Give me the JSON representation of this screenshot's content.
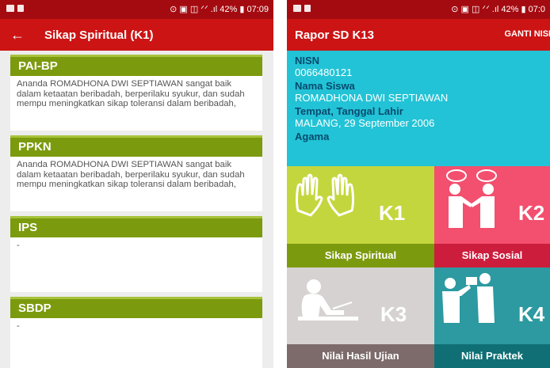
{
  "left_screen": {
    "status": {
      "text": "⊙ ▣ ◫ ᐟᐟ .ıl 42% ▮ 07:09"
    },
    "appbar": {
      "back_icon": "back-arrow-icon",
      "title": "Sikap Spiritual (K1)"
    },
    "cards": [
      {
        "title": "PAI-BP",
        "text": "Ananda ROMADHONA DWI SEPTIAWAN sangat baik dalam ketaatan beribadah, berperilaku syukur, dan sudah mempu meningkatkan sikap toleransi dalam beribadah,"
      },
      {
        "title": "PPKN",
        "text": "Ananda ROMADHONA DWI SEPTIAWAN sangat baik dalam ketaatan beribadah, berperilaku syukur, dan sudah mempu meningkatkan sikap toleransi dalam beribadah,"
      },
      {
        "title": "IPS",
        "text": "-"
      },
      {
        "title": "SBDP",
        "text": "-"
      }
    ]
  },
  "right_screen": {
    "status": {
      "text": "⊙ ▣ ◫ ᐟᐟ .ıl 42% ▮ 07:0"
    },
    "appbar": {
      "title": "Rapor SD K13",
      "action": "GANTI NISN"
    },
    "info": {
      "nisn_label": "NISN",
      "nisn": "0066480121",
      "name_label": "Nama Siswa",
      "name": "ROMADHONA DWI SEPTIAWAN",
      "birth_label": "Tempat, Tanggal Lahir",
      "birth": "MALANG, 29 September 2006",
      "religion_label": "Agama"
    },
    "tiles": [
      {
        "code": "K1",
        "label": "Sikap Spiritual",
        "icon": "praying-hands-icon",
        "color": "#c4d63d",
        "caption_color": "#7c9a0e"
      },
      {
        "code": "K2",
        "label": "Sikap Sosial",
        "icon": "handshake-icon",
        "color": "#f34f6e",
        "caption_color": "#cc1d3d"
      },
      {
        "code": "K3",
        "label": "Nilai Hasil Ujian",
        "icon": "writing-exam-icon",
        "color": "#d6d2d2",
        "caption_color": "#7d6b6b"
      },
      {
        "code": "K4",
        "label": "Nilai Praktek",
        "icon": "presentation-icon",
        "color": "#2c9aa0",
        "caption_color": "#0f6f74"
      }
    ]
  }
}
